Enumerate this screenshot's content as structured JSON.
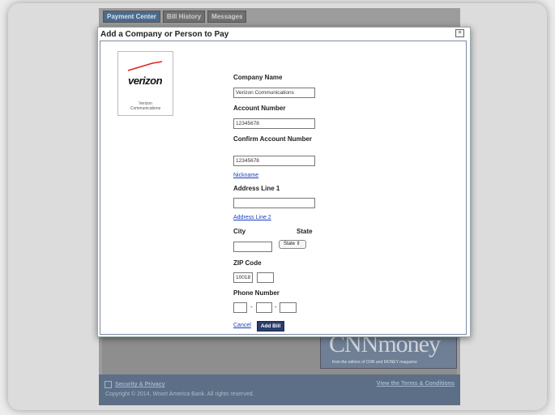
{
  "background": {
    "tabs": [
      "Payment Center",
      "Bill History",
      "Messages"
    ],
    "ad": {
      "logo": "CNNmoney",
      "tagline": "from the editors of CNN and MONEY magazine"
    },
    "footer": {
      "security_link": "Security & Privacy",
      "copyright": "Copyright © 2014, Woort America Bank. All rights reserved.",
      "terms_link": "View the Terms & Conditions"
    }
  },
  "dialog": {
    "title": "Add a Company or Person to Pay",
    "close": "×",
    "payee_logo": {
      "word": "verizon",
      "caption_line1": "Verizon",
      "caption_line2": "Communications"
    },
    "company_name": {
      "label": "Company Name",
      "value": "Verizon Communications"
    },
    "account_number": {
      "label": "Account Number",
      "value": "12345678"
    },
    "confirm_account": {
      "label": "Confirm Account Number",
      "value": "12345678"
    },
    "nickname_link": "Nickname",
    "address1": {
      "label": "Address Line 1",
      "value": ""
    },
    "address2_link": "Address Line 2",
    "city": {
      "label": "City",
      "value": ""
    },
    "state": {
      "label": "State",
      "selected": "State ⇕"
    },
    "zip": {
      "label": "ZIP Code",
      "value": "10018",
      "ext": ""
    },
    "phone": {
      "label": "Phone Number",
      "area": "",
      "prefix": "",
      "line": "",
      "sep": "-"
    },
    "cancel_link": "Cancel",
    "add_button": "Add Bill"
  },
  "colors": {
    "verizon_red": "#e2231a",
    "button_navy": "#2a3d6b",
    "link_blue": "#1a3fc0"
  }
}
